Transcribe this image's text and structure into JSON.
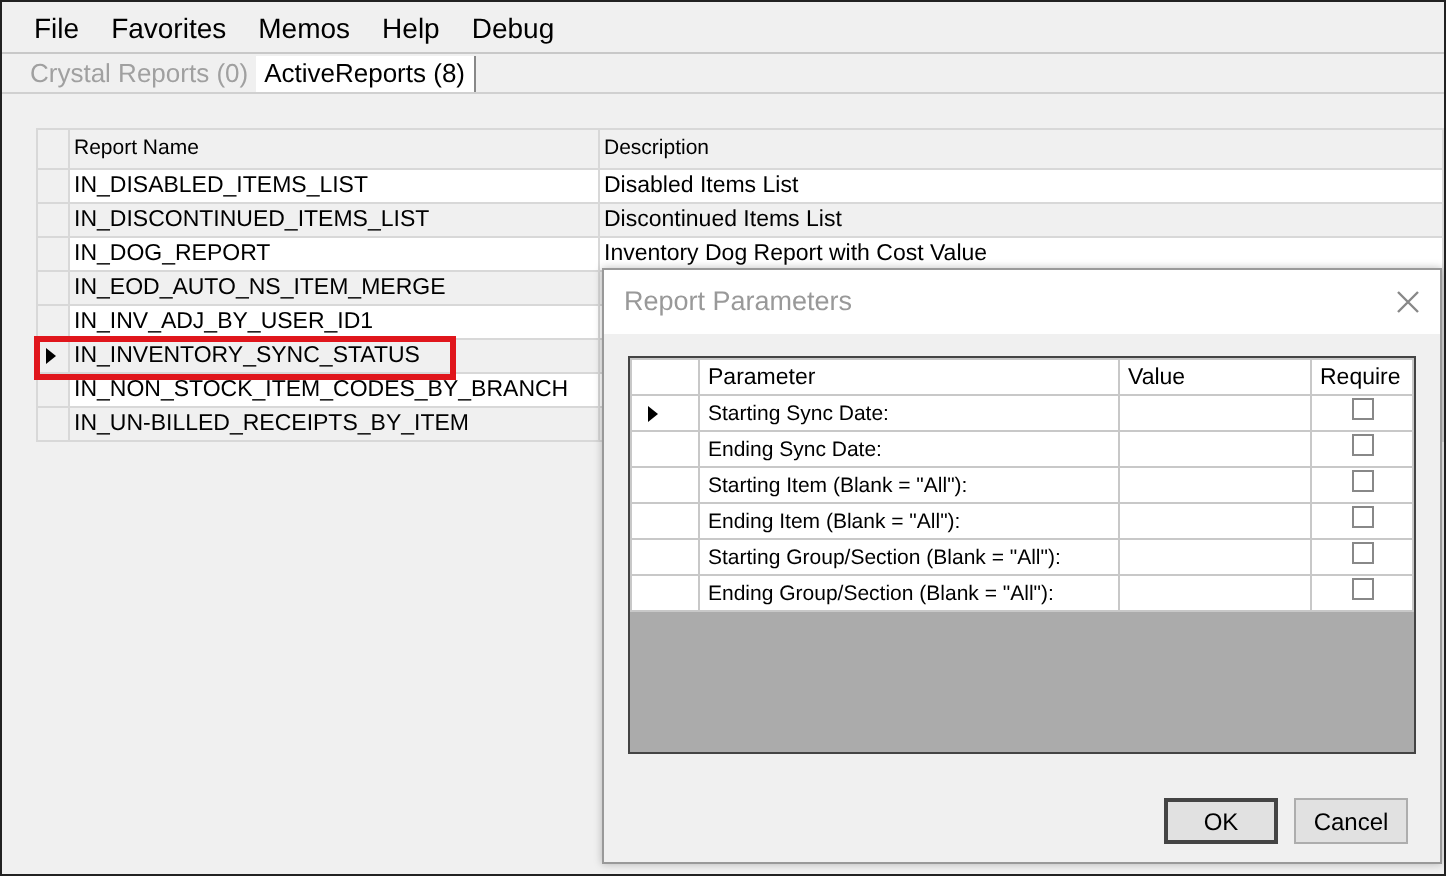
{
  "menu": [
    "File",
    "Favorites",
    "Memos",
    "Help",
    "Debug"
  ],
  "tabs": [
    {
      "label": "Crystal Reports (0)",
      "selected": false,
      "disabled": true
    },
    {
      "label": "ActiveReports (8)",
      "selected": true,
      "disabled": false
    }
  ],
  "report_grid": {
    "columns": [
      "Report Name",
      "Description"
    ],
    "rows": [
      {
        "name": "IN_DISABLED_ITEMS_LIST",
        "description": "Disabled Items List",
        "selected": false,
        "highlighted": false
      },
      {
        "name": "IN_DISCONTINUED_ITEMS_LIST",
        "description": "Discontinued Items List",
        "selected": false,
        "highlighted": false
      },
      {
        "name": "IN_DOG_REPORT",
        "description": "Inventory Dog Report with Cost Value",
        "selected": false,
        "highlighted": false
      },
      {
        "name": "IN_EOD_AUTO_NS_ITEM_MERGE",
        "selected": false,
        "highlighted": false
      },
      {
        "name": "IN_INV_ADJ_BY_USER_ID1",
        "selected": false,
        "highlighted": false
      },
      {
        "name": "IN_INVENTORY_SYNC_STATUS",
        "selected": true,
        "highlighted": true
      },
      {
        "name": "IN_NON_STOCK_ITEM_CODES_BY_BRANCH",
        "selected": false,
        "highlighted": false
      },
      {
        "name": "IN_UN-BILLED_RECEIPTS_BY_ITEM",
        "selected": false,
        "highlighted": false
      }
    ]
  },
  "dialog": {
    "title": "Report Parameters",
    "columns": [
      "Parameter",
      "Value",
      "Require"
    ],
    "rows": [
      {
        "parameter": "Starting Sync Date:",
        "required": false,
        "selected": true
      },
      {
        "parameter": "Ending Sync Date:",
        "required": false,
        "selected": false
      },
      {
        "parameter": "Starting Item (Blank = \"All\"):",
        "required": false,
        "selected": false
      },
      {
        "parameter": "Ending Item (Blank = \"All\"):",
        "required": false,
        "selected": false
      },
      {
        "parameter": "Starting Group/Section (Blank = \"All\"):",
        "required": false,
        "selected": false
      },
      {
        "parameter": "Ending Group/Section (Blank = \"All\"):",
        "required": false,
        "selected": false
      }
    ],
    "buttons": [
      {
        "label": "OK",
        "default": true
      },
      {
        "label": "Cancel",
        "default": false
      }
    ]
  }
}
